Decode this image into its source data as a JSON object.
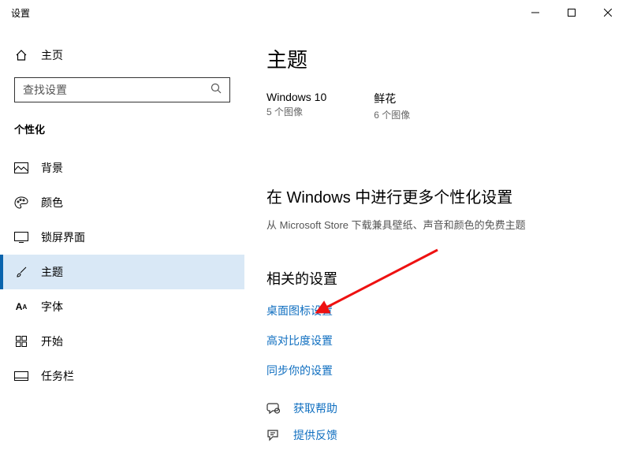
{
  "titlebar": {
    "title": "设置"
  },
  "sidebar": {
    "home_label": "主页",
    "search_placeholder": "查找设置",
    "category": "个性化",
    "items": [
      {
        "key": "background",
        "label": "背景"
      },
      {
        "key": "colors",
        "label": "颜色"
      },
      {
        "key": "lockscreen",
        "label": "锁屏界面"
      },
      {
        "key": "themes",
        "label": "主题"
      },
      {
        "key": "fonts",
        "label": "字体"
      },
      {
        "key": "start",
        "label": "开始"
      },
      {
        "key": "taskbar",
        "label": "任务栏"
      }
    ],
    "selected": 3
  },
  "main": {
    "page_title": "主题",
    "themes": [
      {
        "name": "Windows 10",
        "count": "5 个图像"
      },
      {
        "name": "鲜花",
        "count": "6 个图像"
      }
    ],
    "more_heading": "在 Windows 中进行更多个性化设置",
    "more_sub": "从 Microsoft Store 下载兼具壁纸、声音和颜色的免费主题",
    "related_heading": "相关的设置",
    "links": {
      "desktop_icon": "桌面图标设置",
      "high_contrast": "高对比度设置",
      "sync": "同步你的设置"
    },
    "help": "获取帮助",
    "feedback": "提供反馈"
  }
}
